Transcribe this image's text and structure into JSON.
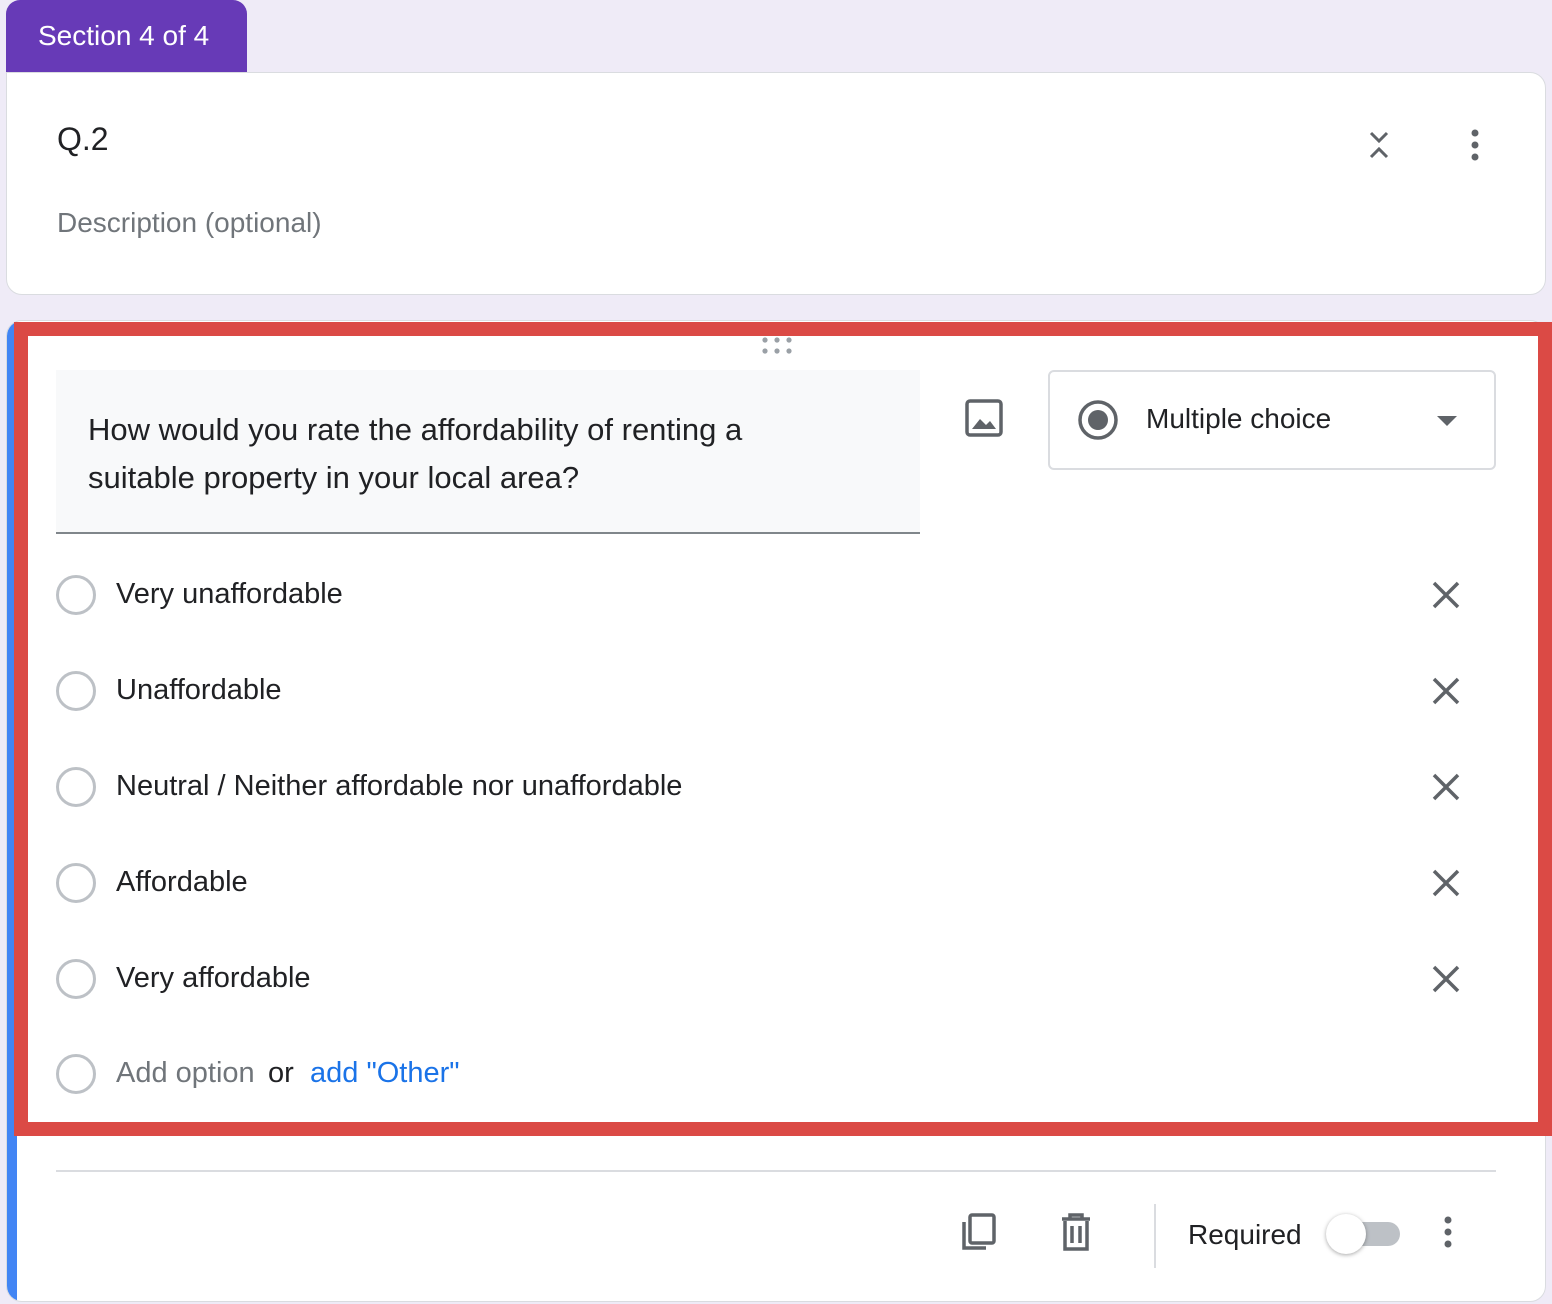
{
  "section": {
    "tab_label": "Section 4 of 4",
    "title": "Q.2",
    "description_placeholder": "Description (optional)"
  },
  "question": {
    "text": "How would you rate the affordability of renting a suitable property in your local area?",
    "type_label": "Multiple choice",
    "options": [
      {
        "label": "Very unaffordable"
      },
      {
        "label": "Unaffordable"
      },
      {
        "label": "Neutral / Neither affordable nor unaffordable"
      },
      {
        "label": "Affordable"
      },
      {
        "label": "Very affordable"
      }
    ],
    "add_option_label": "Add option",
    "or_label": "or",
    "add_other_label": "add \"Other\""
  },
  "footer": {
    "required_label": "Required",
    "required_on": false
  },
  "colors": {
    "accent": "#673ab7",
    "active_bar": "#4285f4",
    "highlight": "#db4a45",
    "link": "#1a73e8"
  },
  "icons": [
    "collapse-icon",
    "more-vert-icon",
    "drag-handle-icon",
    "image-icon",
    "radio-filled-icon",
    "dropdown-arrow-icon",
    "close-icon",
    "copy-icon",
    "trash-icon"
  ]
}
